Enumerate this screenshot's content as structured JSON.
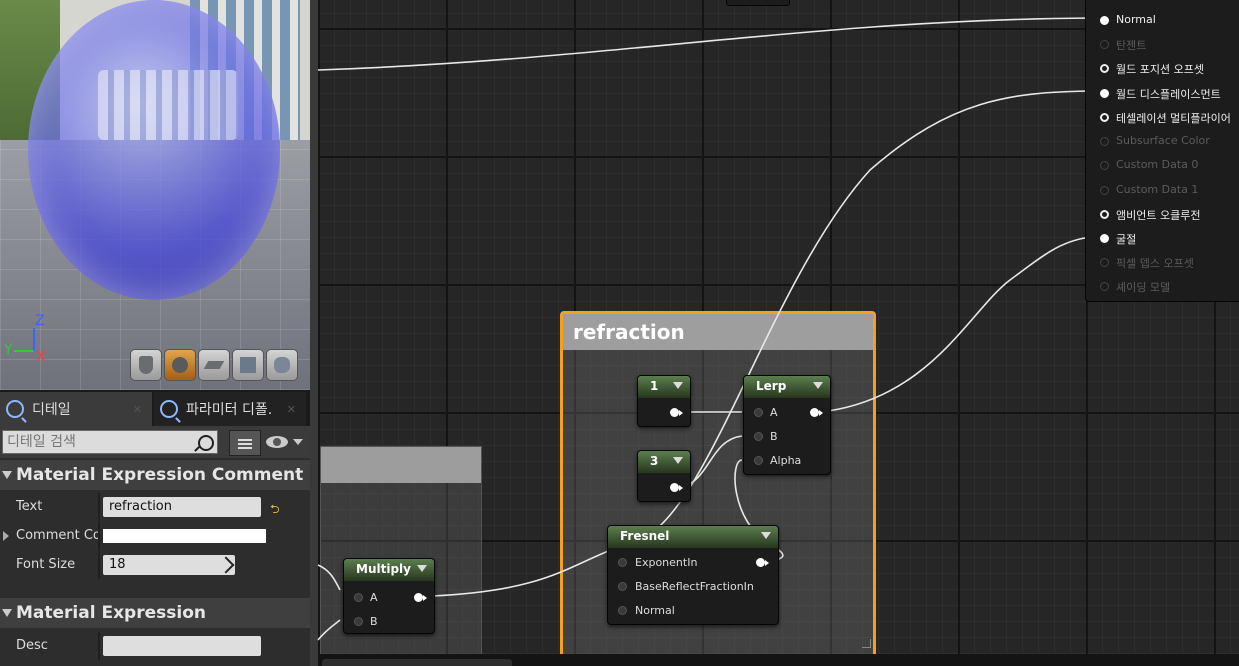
{
  "viewport": {
    "axis_labels": {
      "z": "Z",
      "y": "Y",
      "x": "X"
    },
    "preview_buttons": [
      {
        "icon": "cylinder-icon"
      },
      {
        "icon": "sphere-icon",
        "active": true
      },
      {
        "icon": "plane-icon"
      },
      {
        "icon": "cube-icon"
      },
      {
        "icon": "teapot-icon"
      }
    ]
  },
  "details": {
    "tabs": [
      {
        "label": "디테일",
        "icon": "magnifier-icon"
      },
      {
        "label": "파라미터 디폴.",
        "icon": "magnifier-icon"
      }
    ],
    "search_placeholder": "디테일 검색",
    "categories": [
      {
        "title": "Material Expression Comment",
        "properties": [
          {
            "label": "Text",
            "value": "refraction"
          },
          {
            "label": "Comment Color",
            "value": "",
            "color": "#ffffff"
          },
          {
            "label": "Font Size",
            "value": "18"
          }
        ]
      },
      {
        "title": "Material Expression",
        "properties": [
          {
            "label": "Desc",
            "value": ""
          }
        ]
      }
    ]
  },
  "graph": {
    "comment_title": "refraction",
    "comment_color": "#f1a21a",
    "nodes": {
      "const1": {
        "title": "1"
      },
      "const3": {
        "title": "3"
      },
      "lerp": {
        "title": "Lerp",
        "pins": [
          "A",
          "B",
          "Alpha"
        ]
      },
      "fresnel": {
        "title": "Fresnel",
        "pins": [
          "ExponentIn",
          "BaseReflectFractionIn",
          "Normal"
        ]
      },
      "multiply": {
        "title": "Multiply",
        "pins": [
          "A",
          "B"
        ]
      }
    },
    "material_inputs": [
      {
        "label": "Normal",
        "active": true,
        "connected": true
      },
      {
        "label": "탄젠트",
        "active": false
      },
      {
        "label": "월드 포지션 오프셋",
        "active": true
      },
      {
        "label": "월드 디스플레이스먼트",
        "active": true,
        "connected": true
      },
      {
        "label": "테셀레이션 멀티플라이어",
        "active": true
      },
      {
        "label": "Subsurface Color",
        "active": false
      },
      {
        "label": "Custom Data 0",
        "active": false
      },
      {
        "label": "Custom Data 1",
        "active": false
      },
      {
        "label": "앰비언트 오클루전",
        "active": true
      },
      {
        "label": "굴절",
        "active": true,
        "connected": true
      },
      {
        "label": "픽셀 뎁스 오프셋",
        "active": false
      },
      {
        "label": "셰이딩 모델",
        "active": false
      }
    ]
  }
}
